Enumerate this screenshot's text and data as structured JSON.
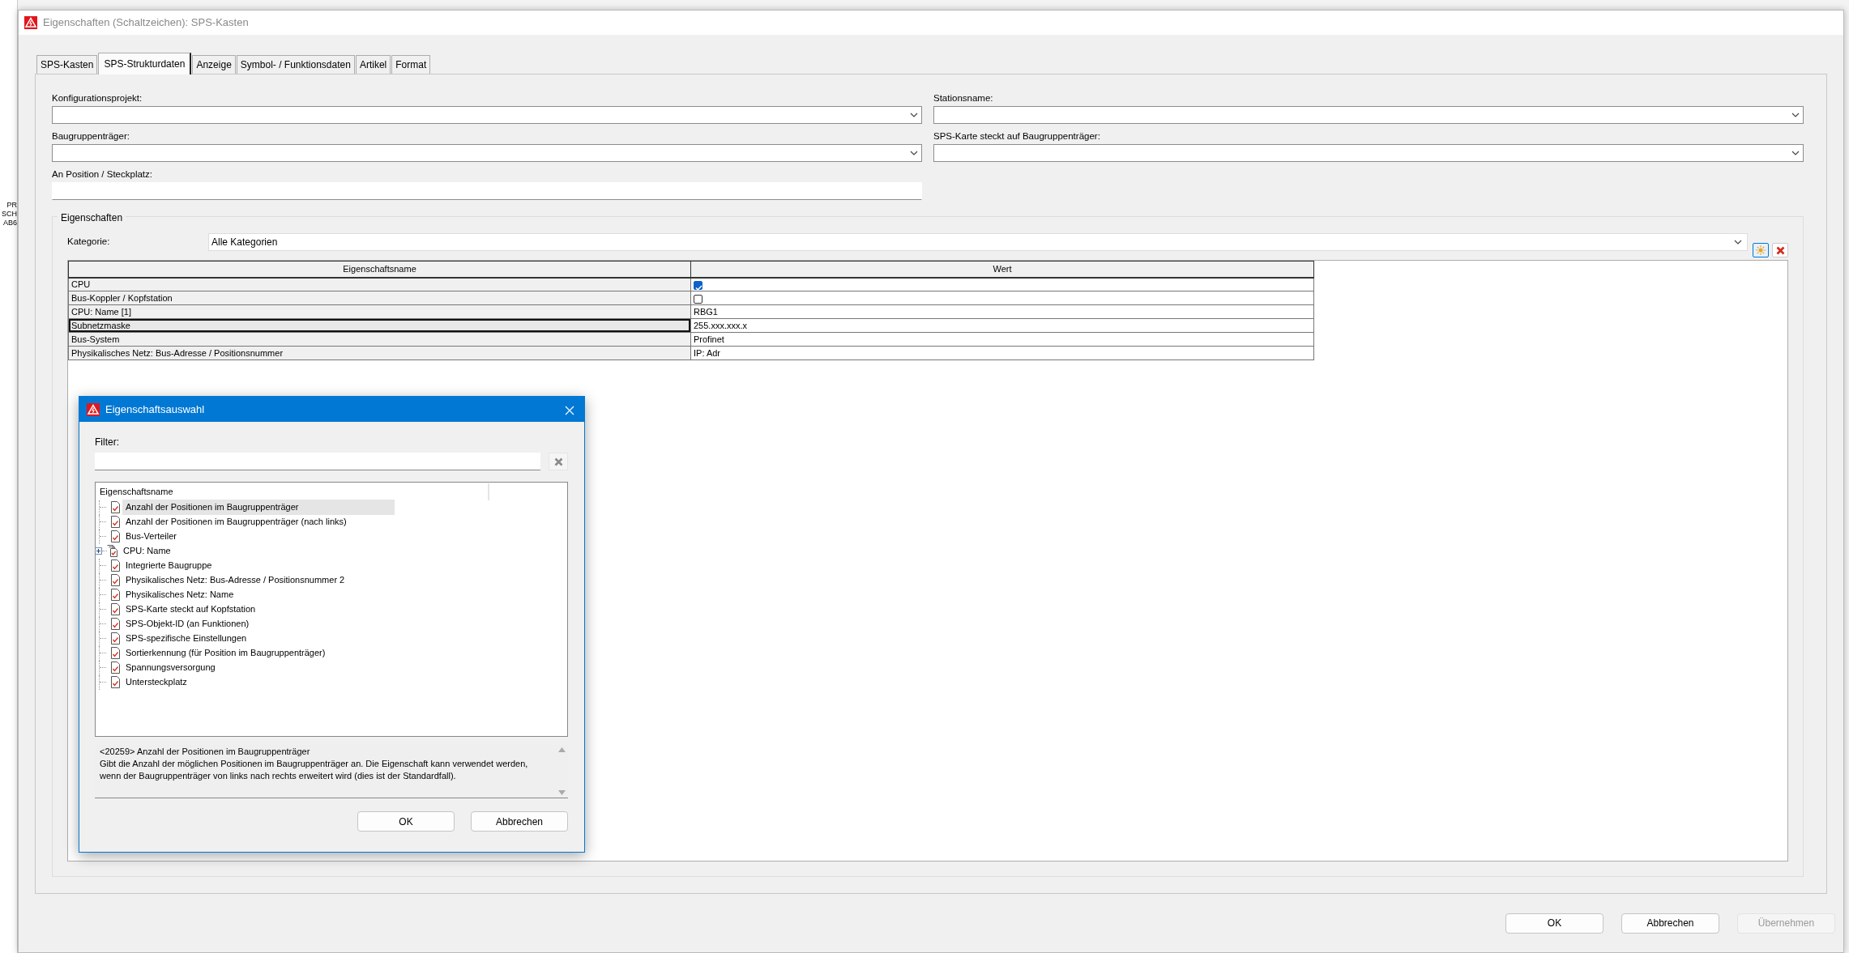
{
  "background": {
    "fragments": [
      "PR",
      "SCH",
      "AB6"
    ]
  },
  "window": {
    "title": "Eigenschaften (Schaltzeichen): SPS-Kasten"
  },
  "tabs": [
    {
      "label": "SPS-Kasten",
      "selected": false
    },
    {
      "label": "SPS-Strukturdaten",
      "selected": true
    },
    {
      "label": "Anzeige",
      "selected": false
    },
    {
      "label": "Symbol- / Funktionsdaten",
      "selected": false
    },
    {
      "label": "Artikel",
      "selected": false
    },
    {
      "label": "Format",
      "selected": false
    }
  ],
  "form": {
    "left": [
      {
        "label": "Konfigurationsprojekt:",
        "kind": "combo"
      },
      {
        "label": "Baugruppenträger:",
        "kind": "combo"
      },
      {
        "label": "An Position / Steckplatz:",
        "kind": "text"
      }
    ],
    "right": [
      {
        "label": "Stationsname:",
        "kind": "combo"
      },
      {
        "label": "SPS-Karte steckt auf Baugruppenträger:",
        "kind": "combo"
      }
    ]
  },
  "properties": {
    "title": "Eigenschaften",
    "category_label": "Kategorie:",
    "category_value": "Alle Kategorien",
    "columns": [
      "Eigenschaftsname",
      "Wert"
    ],
    "rows": [
      {
        "name": "CPU",
        "kind": "checkbox",
        "checked": true,
        "selected": false
      },
      {
        "name": "Bus-Koppler / Kopfstation",
        "kind": "checkbox",
        "checked": false,
        "selected": false
      },
      {
        "name": "CPU: Name [1]",
        "kind": "text",
        "value": "RBG1",
        "selected": false
      },
      {
        "name": "Subnetzmaske",
        "kind": "text",
        "value": "255.xxx.xxx.x",
        "selected": true
      },
      {
        "name": "Bus-System",
        "kind": "text",
        "value": "Profinet",
        "selected": false
      },
      {
        "name": "Physikalisches Netz: Bus-Adresse / Positionsnummer",
        "kind": "text",
        "value": "IP: Adr",
        "selected": false
      }
    ]
  },
  "buttons": [
    {
      "label": "OK",
      "disabled": false
    },
    {
      "label": "Abbrechen",
      "disabled": false
    },
    {
      "label": "Übernehmen",
      "disabled": true
    }
  ],
  "picker": {
    "title": "Eigenschaftsauswahl",
    "filter_label": "Filter:",
    "tree_header": "Eigenschaftsname",
    "items": [
      {
        "label": "Anzahl der Positionen im Baugruppenträger",
        "kind": "leaf",
        "selected": true
      },
      {
        "label": "Anzahl der Positionen im Baugruppenträger (nach links)",
        "kind": "leaf",
        "selected": false
      },
      {
        "label": "Bus-Verteiler",
        "kind": "leaf",
        "selected": false
      },
      {
        "label": "CPU: Name",
        "kind": "group",
        "expanded": false,
        "selected": false
      },
      {
        "label": "Integrierte Baugruppe",
        "kind": "leaf",
        "selected": false
      },
      {
        "label": "Physikalisches Netz: Bus-Adresse / Positionsnummer 2",
        "kind": "leaf",
        "selected": false
      },
      {
        "label": "Physikalisches Netz: Name",
        "kind": "leaf",
        "selected": false
      },
      {
        "label": "SPS-Karte steckt auf Kopfstation",
        "kind": "leaf",
        "selected": false
      },
      {
        "label": "SPS-Objekt-ID (an Funktionen)",
        "kind": "leaf",
        "selected": false
      },
      {
        "label": "SPS-spezifische Einstellungen",
        "kind": "leaf",
        "selected": false
      },
      {
        "label": "Sortierkennung (für Position im Baugruppenträger)",
        "kind": "leaf",
        "selected": false
      },
      {
        "label": "Spannungsversorgung",
        "kind": "leaf",
        "selected": false
      },
      {
        "label": "Untersteckplatz",
        "kind": "leaf",
        "selected": false
      }
    ],
    "description": [
      "<20259> Anzahl der Positionen im Baugruppenträger",
      "Gibt die Anzahl der möglichen Positionen im Baugruppenträger an. Die Eigenschaft kann verwendet werden, wenn der Baugruppenträger von links nach rechts erweitert wird (dies ist der Standardfall)."
    ],
    "buttons": [
      {
        "label": "OK",
        "disabled": false
      },
      {
        "label": "Abbrechen",
        "disabled": false
      }
    ]
  }
}
